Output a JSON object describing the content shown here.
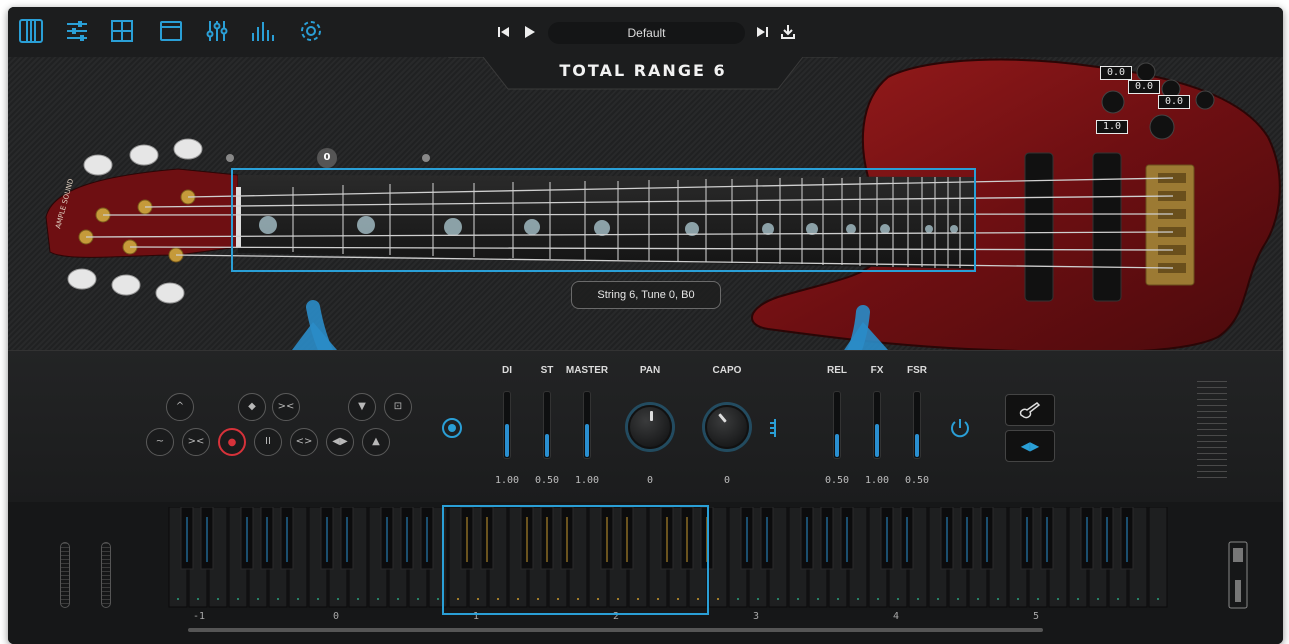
{
  "toolbar": {
    "icons": [
      "instrument-icon",
      "mixer-icon",
      "grid-icon",
      "window-icon",
      "sliders-icon",
      "eq-icon",
      "gear-icon"
    ],
    "preset_name": "Default",
    "accent_color": "#2a9fd6"
  },
  "header": {
    "title": "TOTAL RANGE 6"
  },
  "guitar": {
    "headstock_brand": "AMPLE SOUND",
    "knob_values": [
      "0.0",
      "0.0",
      "0.0",
      "1.0"
    ],
    "fret_marker": "0",
    "status": "String 6, Tune 0, B0"
  },
  "mixer": {
    "labels": {
      "di": "DI",
      "st": "ST",
      "master": "MASTER",
      "pan": "PAN",
      "capo": "CAPO",
      "rel": "REL",
      "fx": "FX",
      "fsr": "FSR"
    },
    "values": {
      "di": "1.00",
      "st": "0.50",
      "master": "1.00",
      "pan": "0",
      "capo": "0",
      "rel": "0.50",
      "fx": "1.00",
      "fsr": "0.50"
    },
    "levels": {
      "di": 0.5,
      "st": 0.35,
      "master": 0.5,
      "rel": 0.35,
      "fx": 0.5,
      "fsr": 0.35
    }
  },
  "articulation_buttons": {
    "row1": [
      "^",
      "◆",
      "><",
      "▼",
      "⊡"
    ],
    "row2": [
      "~",
      "><",
      "●",
      "II",
      "<>",
      "◀▶",
      "▲"
    ]
  },
  "keyboard": {
    "octave_labels": [
      "-1",
      "0",
      "1",
      "2",
      "3",
      "4",
      "5"
    ],
    "selected_range": "1–2"
  },
  "right_buttons": {
    "guitar_icon": "guitar-icon",
    "toggle_label": "◀▶"
  }
}
